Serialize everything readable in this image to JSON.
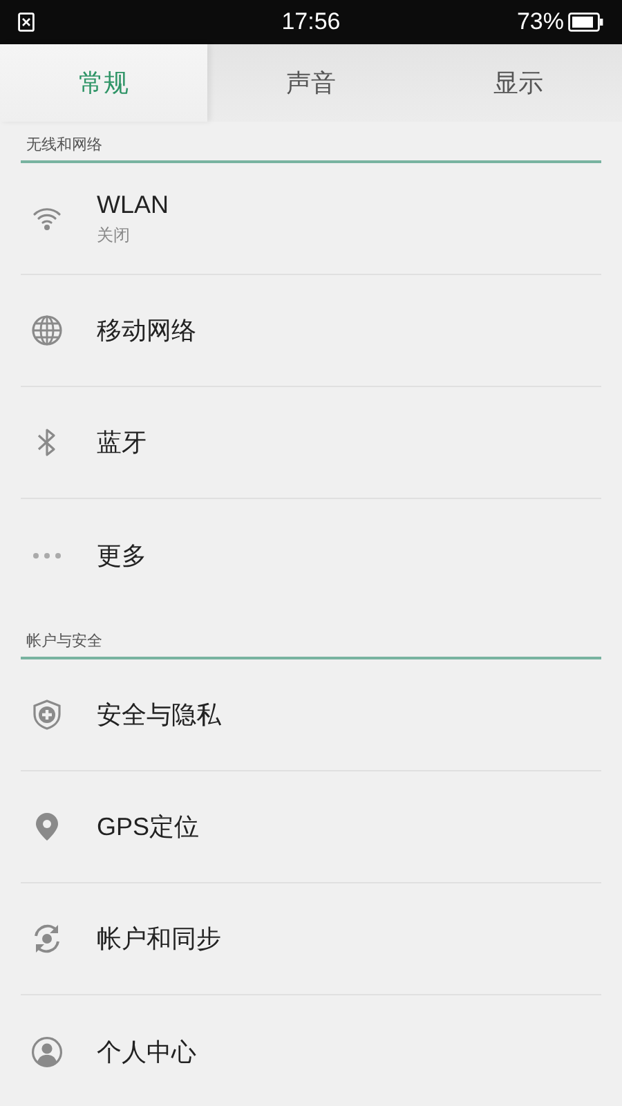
{
  "status_bar": {
    "time": "17:56",
    "battery_text": "73%"
  },
  "tabs": [
    {
      "label": "常规",
      "selected": true
    },
    {
      "label": "声音",
      "selected": false
    },
    {
      "label": "显示",
      "selected": false
    }
  ],
  "sections": [
    {
      "title": "无线和网络",
      "items": [
        {
          "kind": "wifi",
          "label": "WLAN",
          "subtitle": "关闭"
        },
        {
          "kind": "globe",
          "label": "移动网络"
        },
        {
          "kind": "bluetooth",
          "label": "蓝牙"
        },
        {
          "kind": "more",
          "label": "更多"
        }
      ]
    },
    {
      "title": "帐户与安全",
      "items": [
        {
          "kind": "shield",
          "label": "安全与隐私"
        },
        {
          "kind": "pin",
          "label": "GPS定位"
        },
        {
          "kind": "sync",
          "label": "帐户和同步"
        },
        {
          "kind": "person",
          "label": "个人中心"
        }
      ]
    }
  ]
}
